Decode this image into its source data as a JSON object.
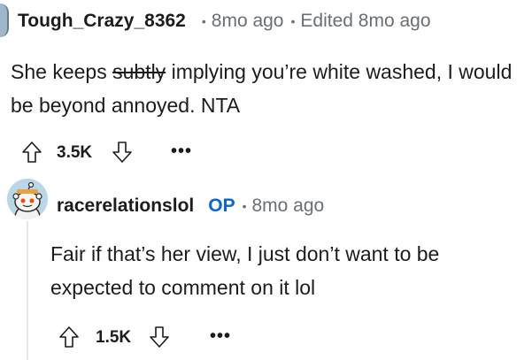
{
  "comment1": {
    "author": "Tough_Crazy_8362",
    "time": "8mo ago",
    "edited": "Edited 8mo ago",
    "separator": "•",
    "body_before": "She keeps ",
    "body_strike": "subtly",
    "body_after": " implying you’re white washed, I would be beyond annoyed. NTA",
    "score": "3.5K",
    "more": "•••"
  },
  "comment2": {
    "author": "racerelationslol",
    "op_badge": "OP",
    "time": "8mo ago",
    "separator": "•",
    "body": "Fair if that’s her view, I just don’t want to be expected to comment on it lol",
    "score": "1.5K",
    "more": "•••"
  },
  "colors": {
    "op": "#0a66d4",
    "meta": "#6a6f73",
    "text": "#1c1c1c",
    "thread_line": "#e6e6e6"
  },
  "icons": [
    "upvote-icon",
    "downvote-icon",
    "more-options-icon",
    "avatar-icon"
  ]
}
